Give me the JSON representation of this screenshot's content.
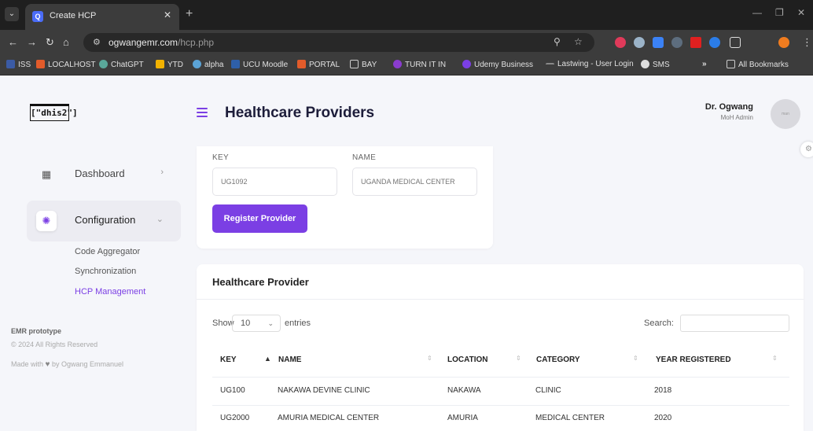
{
  "browser": {
    "tab_title": "Create HCP",
    "tab_icon": "Q",
    "url_domain": "ogwangemr.com",
    "url_path": "/hcp.php",
    "bookmarks": [
      "ISS",
      "LOCALHOST",
      "ChatGPT",
      "YTD",
      "alpha",
      "UCU Moodle",
      "PORTAL",
      "BAY",
      "TURN IT IN",
      "Udemy Business",
      "Lastwing - User Login",
      "SMS"
    ],
    "bookmarks_overflow": "»",
    "all_bookmarks": "All Bookmarks"
  },
  "header": {
    "logo": "[\"dhis2\"]",
    "title": "Healthcare Providers",
    "user_name": "Dr. Ogwang",
    "user_role": "MoH Admin",
    "avatar_text": "man"
  },
  "sidebar": {
    "items": [
      {
        "label": "Dashboard",
        "icon": "dashboard-icon",
        "chevron": "›"
      },
      {
        "label": "Configuration",
        "icon": "settings-icon",
        "chevron": "⌄"
      }
    ],
    "sub_items": [
      "Code Aggregator",
      "Synchronization",
      "HCP Management"
    ],
    "footer_title": "EMR prototype",
    "footer_copy": "© 2024 All Rights Reserved",
    "footer_made_prefix": "Made with",
    "footer_made_suffix": "by Ogwang Emmanuel"
  },
  "form": {
    "key_label": "KEY",
    "name_label": "NAME",
    "key_placeholder": "UG1092",
    "name_placeholder": "UGANDA MEDICAL CENTER",
    "submit_label": "Register Provider"
  },
  "table": {
    "title": "Healthcare Provider",
    "show_label": "Show",
    "entries_value": "10",
    "entries_label": "entries",
    "search_label": "Search:",
    "columns": [
      "KEY",
      "NAME",
      "LOCATION",
      "CATEGORY",
      "YEAR REGISTERED"
    ],
    "rows": [
      [
        "UG100",
        "NAKAWA DEVINE CLINIC",
        "NAKAWA",
        "CLINIC",
        "2018"
      ],
      [
        "UG2000",
        "AMURIA MEDICAL CENTER",
        "AMURIA",
        "MEDICAL CENTER",
        "2020"
      ]
    ]
  },
  "colors": {
    "accent": "#7b3fe4",
    "background": "#f5f6fa"
  }
}
